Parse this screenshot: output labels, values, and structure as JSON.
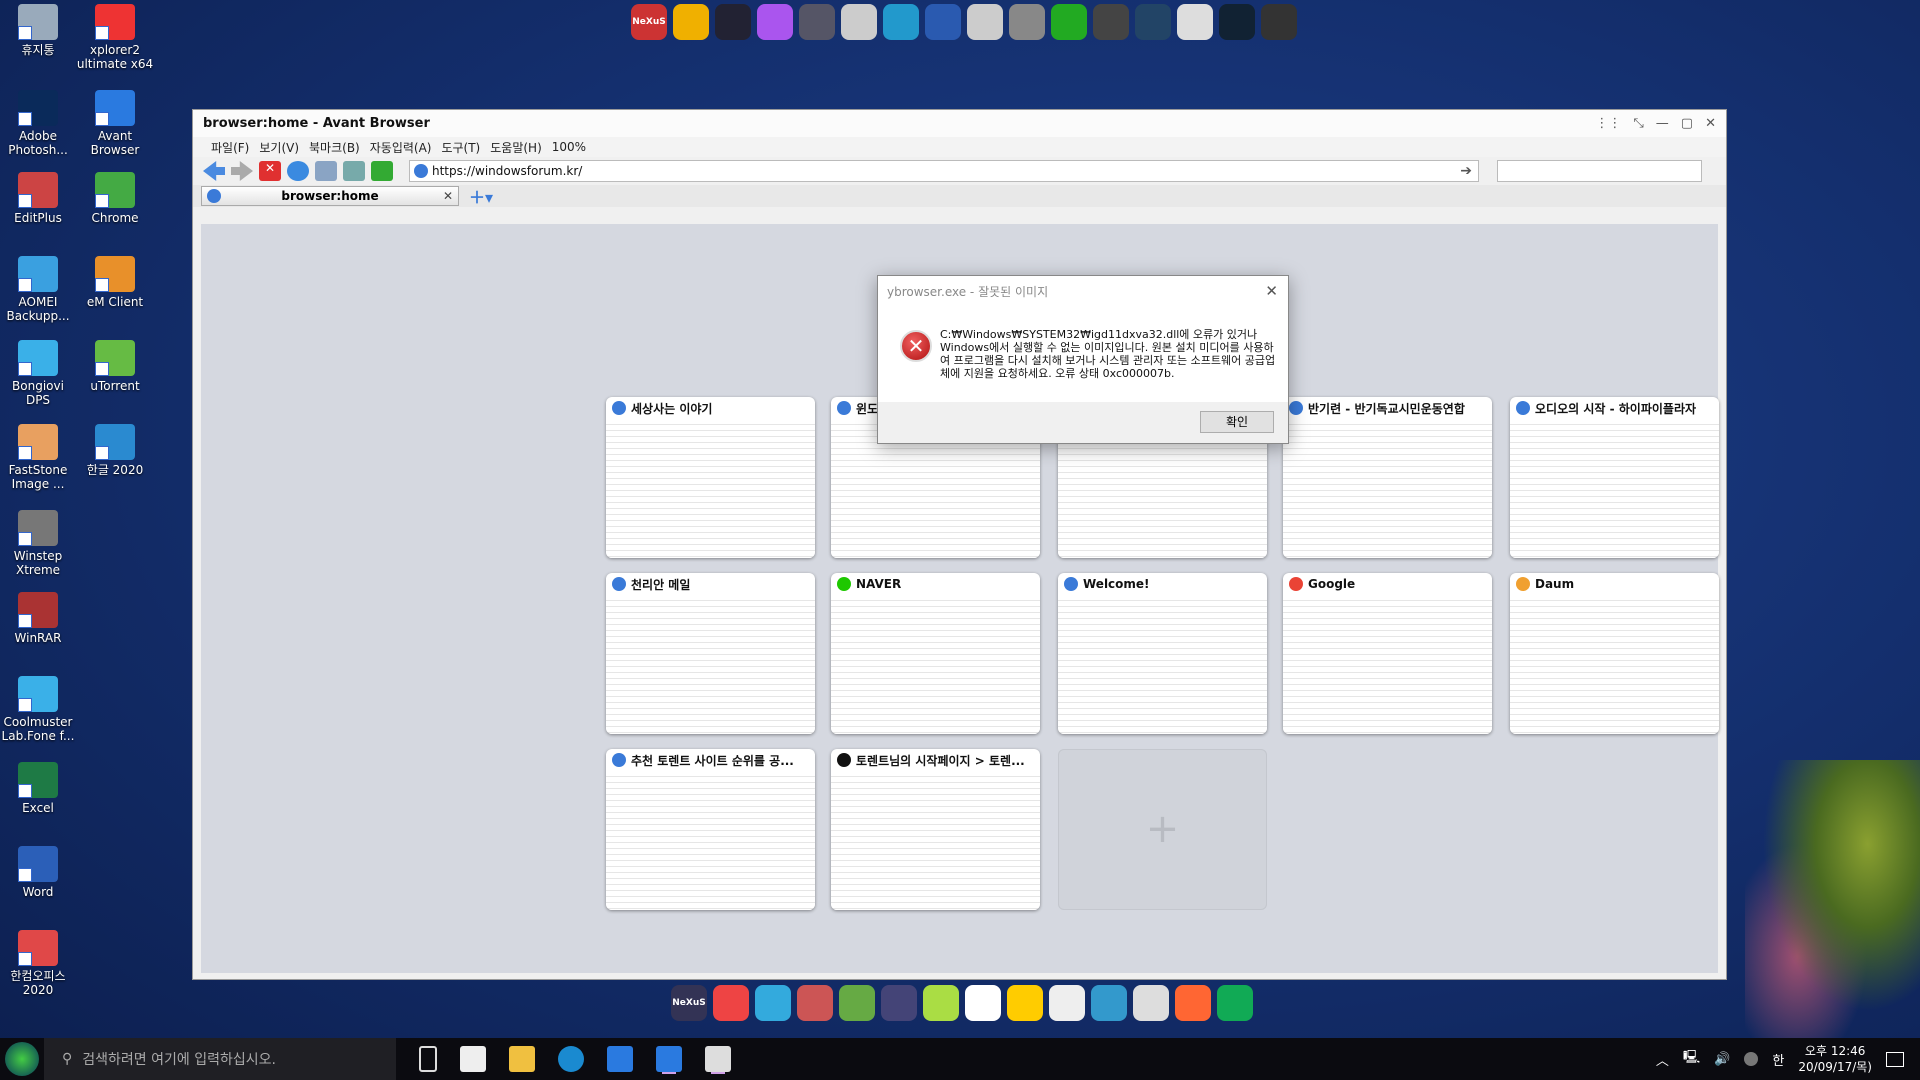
{
  "desktop": {
    "icons": [
      {
        "label": "휴지통",
        "color": "#9ab"
      },
      {
        "label": "xplorer2 ultimate x64",
        "color": "#e33"
      },
      {
        "label": "Adobe Photosh...",
        "color": "#0a2a5a"
      },
      {
        "label": "Avant Browser",
        "color": "#2a7ae0"
      },
      {
        "label": "EditPlus",
        "color": "#c44"
      },
      {
        "label": "Chrome",
        "color": "#4a4"
      },
      {
        "label": "AOMEI Backupp...",
        "color": "#3aa0e0"
      },
      {
        "label": "eM Client",
        "color": "#e8902a"
      },
      {
        "label": "Bongiovi DPS",
        "color": "#3ab0e8"
      },
      {
        "label": "uTorrent",
        "color": "#6b4"
      },
      {
        "label": "FastStone Image ...",
        "color": "#e8a060"
      },
      {
        "label": "한글 2020",
        "color": "#2a8ad0"
      },
      {
        "label": "Winstep Xtreme",
        "color": "#777"
      },
      {
        "label": "WinRAR",
        "color": "#a33"
      },
      {
        "label": "Coolmuster Lab.Fone f...",
        "color": "#3ab0e8"
      },
      {
        "label": "Excel",
        "color": "#1e7a45"
      },
      {
        "label": "Word",
        "color": "#2b5fb8"
      },
      {
        "label": "한컴오피스 2020",
        "color": "#e04848"
      }
    ]
  },
  "top_dock": {
    "label_nexus": "NeXuS"
  },
  "bottom_dock": {
    "label_nexus": "NeXuS"
  },
  "browser": {
    "title": "browser:home - Avant Browser",
    "menu": [
      "파일(F)",
      "보기(V)",
      "북마크(B)",
      "자동입력(A)",
      "도구(T)",
      "도움말(H)",
      "100%"
    ],
    "url": "https://windowsforum.kr/",
    "tab": "browser:home",
    "tiles": [
      {
        "title": "세상사는 이야기",
        "fav": "#3a7ad8"
      },
      {
        "title": "윈도",
        "fav": "#3a7ad8"
      },
      {
        "title": "",
        "fav": "#3a7ad8"
      },
      {
        "title": "반기련 - 반기독교시민운동연합",
        "fav": "#3a7ad8"
      },
      {
        "title": "오디오의 시작 - 하이파이플라자",
        "fav": "#3a7ad8"
      },
      {
        "title": "천리안 메일",
        "fav": "#3a7ad8"
      },
      {
        "title": "NAVER",
        "fav": "#1ec800"
      },
      {
        "title": "Welcome!",
        "fav": "#3a7ad8"
      },
      {
        "title": "Google",
        "fav": "#ea4335"
      },
      {
        "title": "Daum",
        "fav": "#f0a030"
      },
      {
        "title": "추천 토렌트 사이트 순위를 공...",
        "fav": "#3a7ad8"
      },
      {
        "title": "토렌트님의 시작페이지 > 토렌...",
        "fav": "#111"
      },
      {
        "title": "",
        "empty": true,
        "plus": "+"
      }
    ]
  },
  "dialog": {
    "title": "ybrowser.exe - 잘못된 이미지",
    "message": "C:₩Windows₩SYSTEM32₩igd11dxva32.dll에 오류가 있거나 Windows에서 실행할 수 없는 이미지입니다. 원본 설치 미디어를 사용하여 프로그램을 다시 설치해 보거나 시스템 관리자 또는 소프트웨어 공급업체에 지원을 요청하세요. 오류 상태 0xc000007b.",
    "ok": "확인"
  },
  "taskbar": {
    "search_placeholder": "검색하려면 여기에 입력하십시오.",
    "ime": "한",
    "time": "오후 12:46",
    "date": "20/09/17/목)"
  }
}
